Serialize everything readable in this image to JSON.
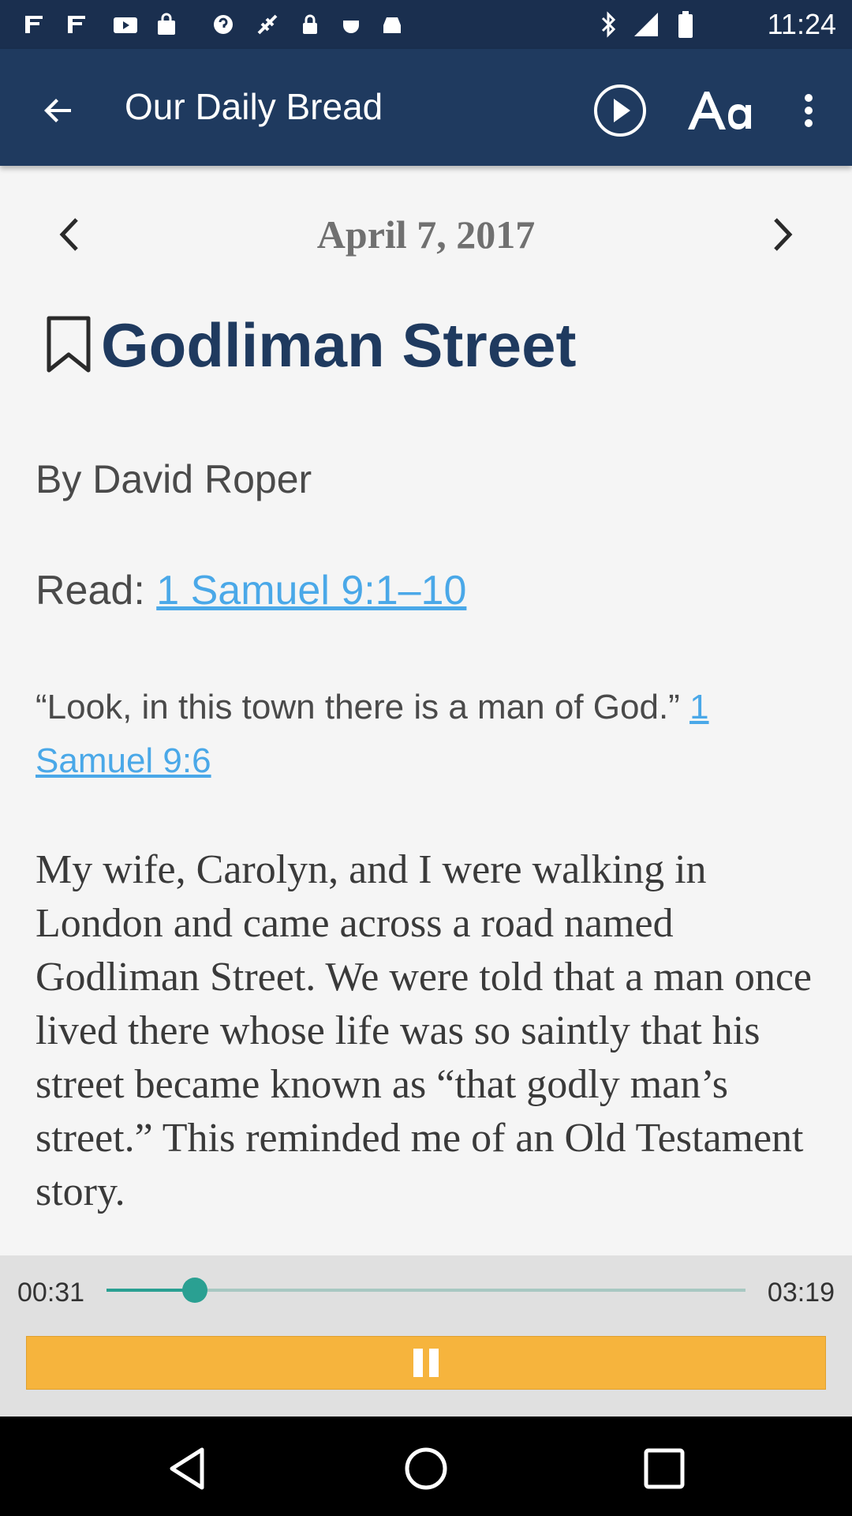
{
  "status_bar": {
    "time": "11:24"
  },
  "app_bar": {
    "title": "Our Daily Bread"
  },
  "devotional": {
    "date": "April 7, 2017",
    "title": "Godliman Street",
    "author": "By David Roper",
    "read_label": "Read: ",
    "read_link": "1 Samuel 9:1–10",
    "verse_text": "“Look, in this town there is a man of God.” ",
    "verse_ref": "1 Samuel 9:6",
    "body": "My wife, Carolyn, and I were walking in London and came across a road named Godliman Street. We were told that a man once lived there whose life was so saintly that his street became known as “that godly man’s street.” This reminded me of an Old Testament story."
  },
  "player": {
    "elapsed": "00:31",
    "duration": "03:19",
    "progress": 0.138
  },
  "colors": {
    "app_bar": "#1f3a5f",
    "heading": "#1f3a5f",
    "link": "#4aa8e8",
    "accent_teal": "#2aa092",
    "pause_bar": "#f6b43d"
  }
}
